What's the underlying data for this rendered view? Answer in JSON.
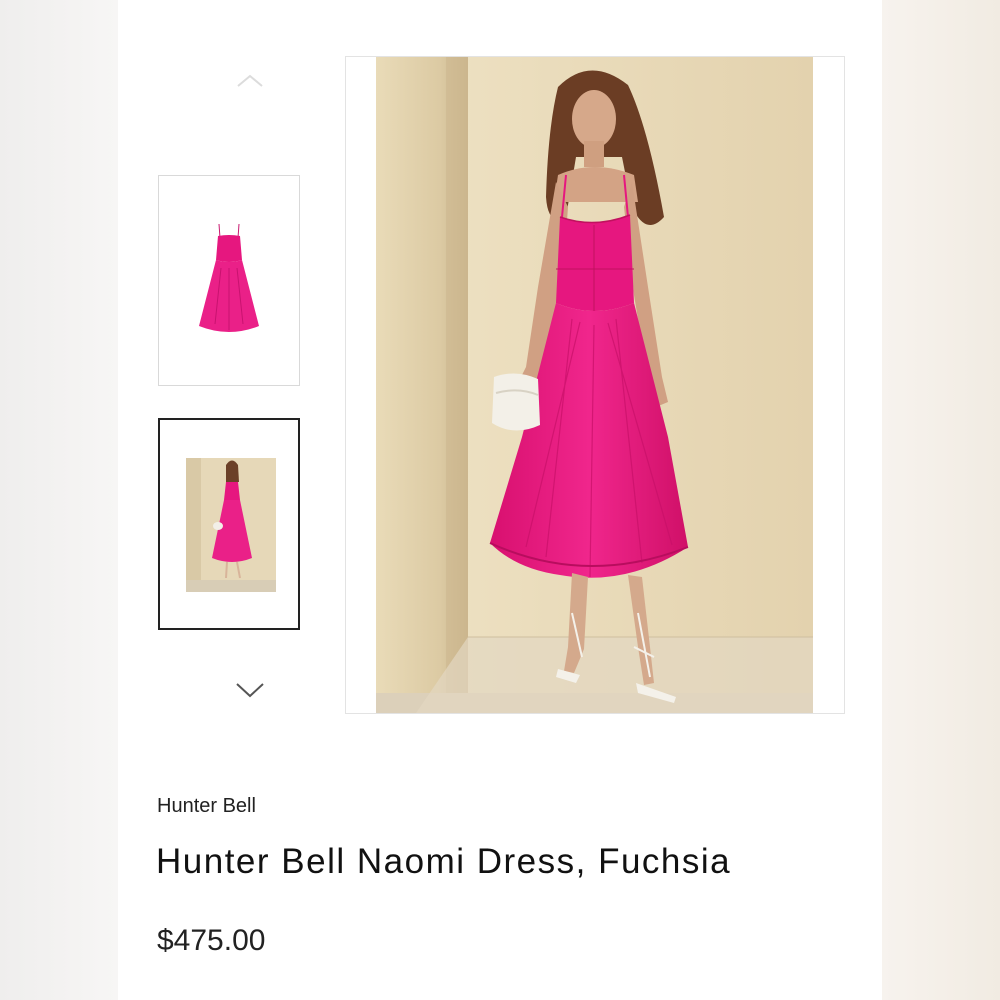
{
  "product": {
    "brand": "Hunter Bell",
    "title": "Hunter Bell Naomi Dress, Fuchsia",
    "price": "$475.00"
  },
  "gallery": {
    "thumbnails": [
      {
        "icon": "dress-flatlay-image",
        "selected": false
      },
      {
        "icon": "model-photo-image",
        "selected": true
      }
    ],
    "nav_icons": [
      "chevron-up-icon",
      "chevron-down-icon"
    ]
  },
  "colors": {
    "dress": "#e6177f",
    "background_wall": "#e8d9b8",
    "selected_border": "#222222"
  }
}
